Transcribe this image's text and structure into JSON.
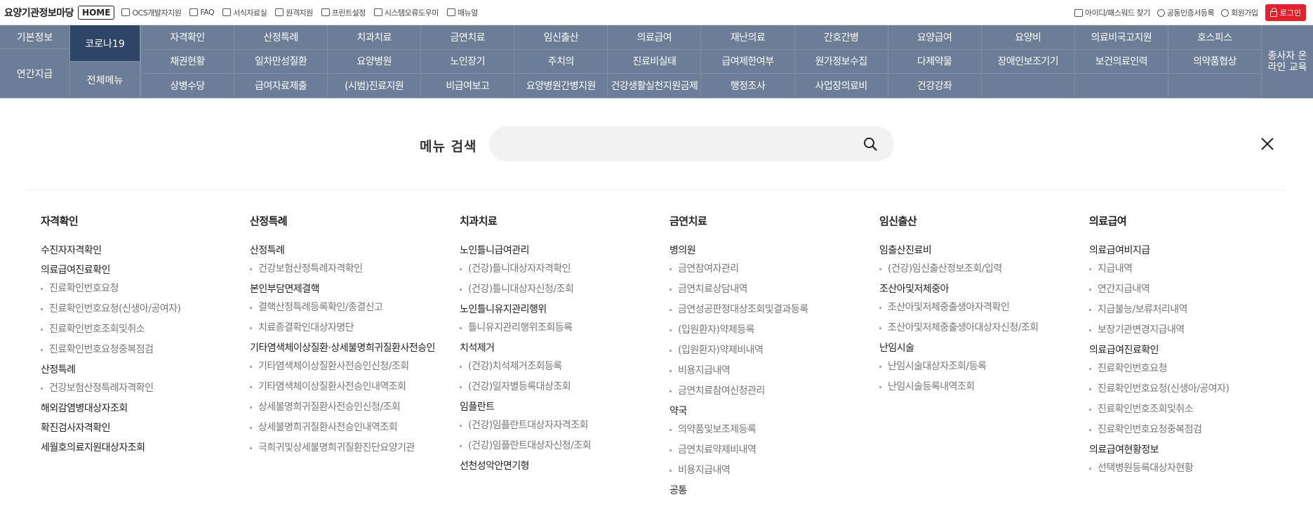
{
  "top": {
    "site_title": "요양기관정보마당",
    "home": "HOME",
    "links": [
      {
        "label": "OCS개발자지원",
        "icon": "window-icon"
      },
      {
        "label": "FAQ",
        "icon": "chat-icon"
      },
      {
        "label": "서식자료실",
        "icon": "book-icon"
      },
      {
        "label": "원격지원",
        "icon": "monitor-icon"
      },
      {
        "label": "프린트설정",
        "icon": "printer-icon"
      },
      {
        "label": "시스템오류도우미",
        "icon": "printer-icon"
      },
      {
        "label": "매뉴얼",
        "icon": "document-icon"
      }
    ],
    "right_links": [
      {
        "label": "아이디/패스워드 찾기",
        "icon": "id-card-icon"
      },
      {
        "label": "공동인증서등록",
        "icon": "shield-icon"
      },
      {
        "label": "회원가입",
        "icon": "person-icon"
      }
    ],
    "login": "로그인"
  },
  "nav": {
    "left": [
      "기본정보",
      "코로나19",
      "연간지급",
      "전체메뉴"
    ],
    "rows": [
      [
        "자격확인",
        "산정특례",
        "치과치료",
        "금연치료",
        "임신출산",
        "의료급여",
        "재난의료",
        "간호간병",
        "요양급여",
        "요양비",
        "의료비국고지원",
        "호스피스"
      ],
      [
        "채권현황",
        "일차만성질환",
        "요양병원",
        "노인장기",
        "주치의",
        "진료비실태",
        "급여제한여부",
        "원가정보수집",
        "다제약물",
        "장애인보조기기",
        "보건의료인력",
        "의약품협상"
      ],
      [
        "상병수당",
        "급여자료제출",
        "(시범)진료지원",
        "비급여보고",
        "요양병원간병지원",
        "건강생활실천지원금제",
        "행정조사",
        "사업장의료비",
        "건강강좌",
        "",
        "",
        ""
      ]
    ],
    "edu": "종사자 온라인 교육"
  },
  "search": {
    "label": "메뉴 검색",
    "placeholder": "",
    "value": ""
  },
  "menu": [
    {
      "title": "자격확인",
      "groups": [
        {
          "title": "수진자자격확인",
          "items": []
        },
        {
          "title": "의료급여진료확인",
          "items": [
            "진료확인번호요청",
            "진료확인번호요청(신생아/공여자)",
            "진료확인번호조회및취소",
            "진료확인번호요청중복점검"
          ]
        },
        {
          "title": "산정특례",
          "items": [
            "건강보험산정특례자격확인"
          ]
        },
        {
          "title": "해외감염병대상자조회",
          "items": []
        },
        {
          "title": "확진검사자격확인",
          "items": []
        },
        {
          "title": "세월호의료지원대상자조회",
          "items": []
        }
      ]
    },
    {
      "title": "산정특례",
      "groups": [
        {
          "title": "산정특례",
          "items": [
            "건강보험산정특례자격확인"
          ]
        },
        {
          "title": "본인부담면제결핵",
          "items": [
            "결핵산정특례등록확인/종결신고",
            "치료종결확인대상자명단"
          ]
        },
        {
          "title": "기타염색체이상질환·상세불명희귀질환사전승인",
          "items": [
            "기타염색체이상질환사전승인신청/조회",
            "기타염색체이상질환사전승인내역조회",
            "상세불명희귀질환사전승인신청/조회",
            "상세불명희귀질환사전승인내역조회",
            "극희귀및상세불명희귀질환진단요양기관"
          ]
        }
      ]
    },
    {
      "title": "치과치료",
      "groups": [
        {
          "title": "노인틀니급여관리",
          "items": [
            "(건강)틀니대상자자격확인",
            "(건강)틀니대상자신청/조회"
          ]
        },
        {
          "title": "노인틀니유지관리행위",
          "items": [
            "틀니유지관리행위조회등록"
          ]
        },
        {
          "title": "치석제거",
          "items": [
            "(건강)치석제거조회등록",
            "(건강)일자별등록대상조회"
          ]
        },
        {
          "title": "임플란트",
          "items": [
            "(건강)임플란트대상자자격조회",
            "(건강)임플란트대상자신청/조회"
          ]
        },
        {
          "title": "선천성악안면기형",
          "items": []
        }
      ]
    },
    {
      "title": "금연치료",
      "groups": [
        {
          "title": "병의원",
          "items": [
            "금연참여자관리",
            "금연치료상담내역",
            "금연성공판정대상조회및결과등록",
            "(입원환자)약제등록",
            "(입원환자)약제비내역",
            "비용지급내역",
            "금연치료참여신청관리"
          ]
        },
        {
          "title": "약국",
          "items": [
            "의약품및보조제등록",
            "금연치료약제비내역",
            "비용지급내역"
          ]
        },
        {
          "title": "공통",
          "items": []
        }
      ]
    },
    {
      "title": "임신출산",
      "groups": [
        {
          "title": "임출산진료비",
          "items": [
            "(건강)임신출산정보조회/입력"
          ]
        },
        {
          "title": "조산아및저체중아",
          "items": [
            "조산아및저체중출생아자격확인",
            "조산아및저체중출생아대상자신청/조회"
          ]
        },
        {
          "title": "난임시술",
          "items": [
            "난임시술대상자조회/등록",
            "난임시술등록내역조회"
          ]
        }
      ]
    },
    {
      "title": "의료급여",
      "groups": [
        {
          "title": "의료급여비지급",
          "items": [
            "지급내역",
            "연간지급내역",
            "지급불능/보류처리내역",
            "보장기관변경지급내역"
          ]
        },
        {
          "title": "의료급여진료확인",
          "items": [
            "진료확인번호요청",
            "진료확인번호요청(신생아/공여자)",
            "진료확인번호조회및취소",
            "진료확인번호요청중복점검"
          ]
        },
        {
          "title": "의료급여현황정보",
          "items": [
            "선택병원등록대상자현황"
          ]
        }
      ]
    }
  ]
}
